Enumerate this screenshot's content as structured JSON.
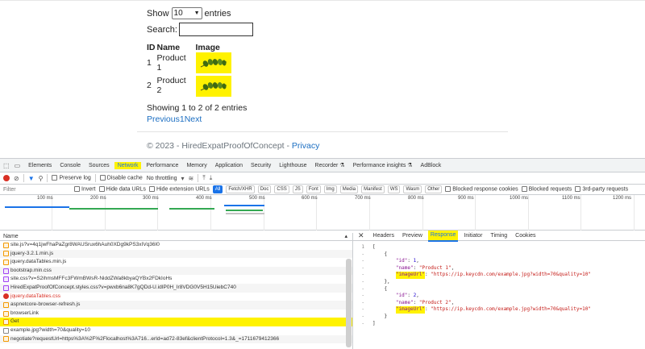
{
  "datatable": {
    "show_label": "Show",
    "entries_value": "10",
    "entries_label": "entries",
    "search_label": "Search:",
    "headers": [
      "ID",
      "Name",
      "Image"
    ],
    "rows": [
      {
        "id": "1",
        "name_line1": "Product",
        "name_line2": "1"
      },
      {
        "id": "2",
        "name_line1": "Product",
        "name_line2": "2"
      }
    ],
    "info": "Showing 1 to 2 of 2 entries",
    "pager": {
      "previous": "Previous",
      "page": "1",
      "next": "Next"
    }
  },
  "footer": {
    "text": "© 2023 - HiredExpatProofOfConcept - ",
    "link": "Privacy"
  },
  "devtools": {
    "tabs": [
      "Elements",
      "Console",
      "Sources",
      "Network",
      "Performance",
      "Memory",
      "Application",
      "Security",
      "Lighthouse",
      "Recorder ⚗",
      "Performance insights ⚗",
      "AdBlock"
    ],
    "active_tab": "Network",
    "toolbar": {
      "preserve_log": "Preserve log",
      "disable_cache": "Disable cache",
      "throttling": "No throttling"
    },
    "filter": {
      "placeholder": "Filter",
      "invert": "Invert",
      "hide_data_urls": "Hide data URLs",
      "hide_extension_urls": "Hide extension URLs",
      "types": [
        "All",
        "Fetch/XHR",
        "Doc",
        "CSS",
        "JS",
        "Font",
        "Img",
        "Media",
        "Manifest",
        "WS",
        "Wasm",
        "Other"
      ],
      "blocked_response_cookies": "Blocked response cookies",
      "blocked_requests": "Blocked requests",
      "third_party": "3rd-party requests"
    },
    "timeline_ticks": [
      "100 ms",
      "200 ms",
      "300 ms",
      "400 ms",
      "500 ms",
      "600 ms",
      "700 ms",
      "800 ms",
      "900 ms",
      "1000 ms",
      "1100 ms",
      "1200 ms"
    ],
    "requests_header": "Name",
    "requests": [
      {
        "type": "js",
        "name": "site.js?v=4q1jwFhaPaZgr8WAUSrux6hAuh0XDg9kPS3xIVq36I0"
      },
      {
        "type": "js",
        "name": "jquery-3.2.1.min.js"
      },
      {
        "type": "js",
        "name": "jquery.dataTables.min.js"
      },
      {
        "type": "css",
        "name": "bootstrap.min.css"
      },
      {
        "type": "css",
        "name": "site.css?v=S2ihmsMFFc3FWmBWsR-NiddZWa8kbyaQYBx2FDkIoHs"
      },
      {
        "type": "css",
        "name": "HiredExpatProofOfConcept.styles.css?v=pwxb6na8K7gQDd-U.idIP0H_Ir8VDG0V5H15UiebC740"
      },
      {
        "type": "err",
        "name": "jquery.dataTables.css"
      },
      {
        "type": "js",
        "name": "aspnetcore-browser-refresh.js"
      },
      {
        "type": "js",
        "name": "browserLink"
      },
      {
        "type": "xhr",
        "name": "Get"
      },
      {
        "type": "img",
        "name": "example.jpg?width=70&quality=10"
      },
      {
        "type": "xhr",
        "name": "negotiate?requestUrl=https%3A%2F%2Flocalhost%3A716...erId=ad72-83ef&clientProtocol=1.3&_=1711679412366"
      }
    ],
    "detail_tabs": [
      "Headers",
      "Preview",
      "Response",
      "Initiator",
      "Timing",
      "Cookies"
    ],
    "active_detail_tab": "Response",
    "response": {
      "line_no": "1",
      "item1": {
        "id": "1",
        "name": "\"Product 1\"",
        "imageUrl": "\"https://ip.keycdn.com/example.jpg?width=70&quality=10\""
      },
      "item2": {
        "id": "2",
        "name": "\"Product 2\"",
        "imageUrl": "\"https://ip.keycdn.com/example.jpg?width=70&quality=10\""
      },
      "keys": {
        "id": "\"id\"",
        "name": "\"name\"",
        "imageUrl": "\"imageUrl\""
      }
    }
  },
  "colors": {
    "highlight": "#fff200",
    "link": "#1b6ec2",
    "devtools_accent": "#1a73e8"
  }
}
